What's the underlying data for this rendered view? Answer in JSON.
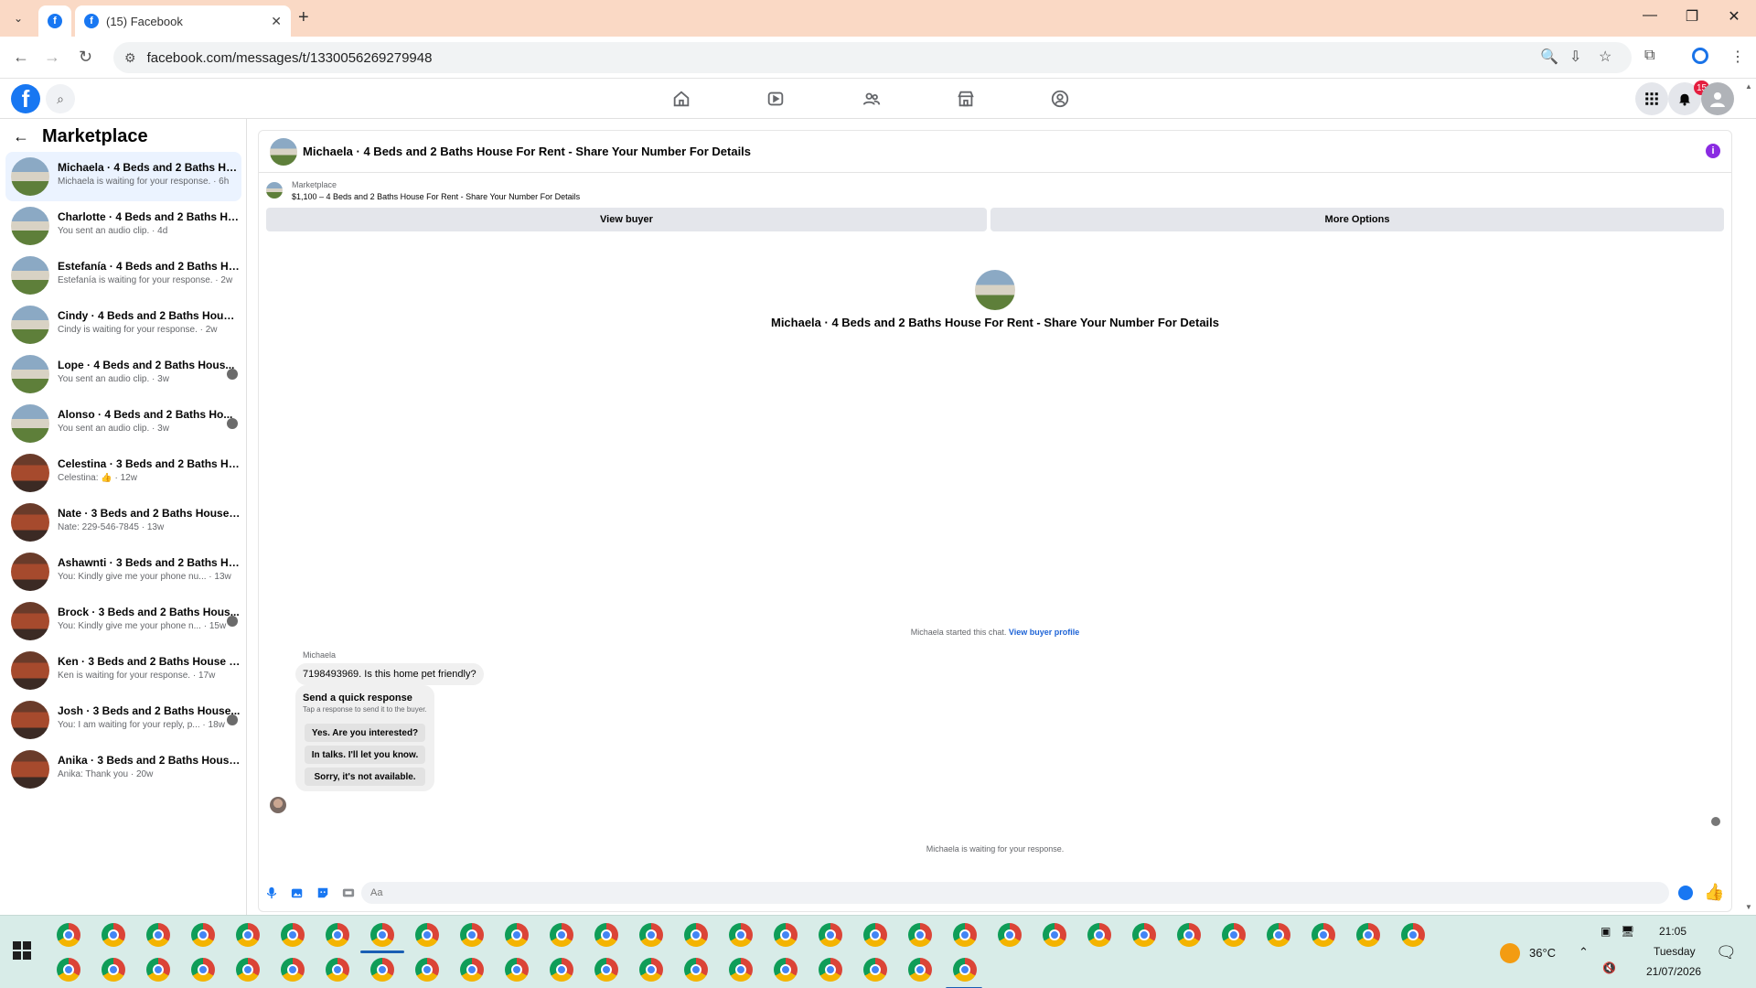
{
  "browser": {
    "tab_title": "(15) Facebook",
    "url": "facebook.com/messages/t/1330056269279948"
  },
  "fb": {
    "notif_count": "15"
  },
  "sidebar": {
    "title": "Marketplace",
    "items": [
      {
        "title": "Michaela · 4 Beds and 2 Baths Hou...",
        "sub": "Michaela is waiting for your response. · 6h",
        "thumb": "green",
        "seen": false
      },
      {
        "title": "Charlotte · 4 Beds and 2 Baths Ho...",
        "sub": "You sent an audio clip. · 4d",
        "thumb": "green",
        "seen": false
      },
      {
        "title": "Estefanía · 4 Beds and 2 Baths Hou...",
        "sub": "Estefanía is waiting for your response. · 2w",
        "thumb": "green",
        "seen": false
      },
      {
        "title": "Cindy · 4 Beds and 2 Baths House ...",
        "sub": "Cindy is waiting for your response. · 2w",
        "thumb": "green",
        "seen": false
      },
      {
        "title": "Lope · 4 Beds and 2 Baths Hous...",
        "sub": "You sent an audio clip. · 3w",
        "thumb": "green",
        "seen": true
      },
      {
        "title": "Alonso · 4 Beds and 2 Baths Ho...",
        "sub": "You sent an audio clip. · 3w",
        "thumb": "green",
        "seen": true
      },
      {
        "title": "Celestina · 3 Beds and 2 Baths Hou...",
        "sub": "Celestina: 👍 · 12w",
        "thumb": "brick",
        "seen": false
      },
      {
        "title": "Nate · 3 Beds and 2 Baths House F...",
        "sub": "Nate: 229-546-7845 · 13w",
        "thumb": "brick",
        "seen": false
      },
      {
        "title": "Ashawnti · 3 Beds and 2 Baths Ho...",
        "sub": "You: Kindly give me your phone nu... · 13w",
        "thumb": "brick",
        "seen": false
      },
      {
        "title": "Brock · 3 Beds and 2 Baths Hous...",
        "sub": "You: Kindly give me your phone n... · 15w",
        "thumb": "brick",
        "seen": true
      },
      {
        "title": "Ken · 3 Beds and 2 Baths House Fo...",
        "sub": "Ken is waiting for your response. · 17w",
        "thumb": "brick",
        "seen": false
      },
      {
        "title": "Josh · 3 Beds and 2 Baths House...",
        "sub": "You: I am waiting for your reply, p... · 18w",
        "thumb": "brick",
        "seen": true
      },
      {
        "title": "Anika · 3 Beds and 2 Baths House ...",
        "sub": "Anika: Thank you · 20w",
        "thumb": "brick",
        "seen": false
      }
    ]
  },
  "chat": {
    "title": "Michaela · 4 Beds and 2 Baths House For Rent - Share Your Number For Details",
    "marketplace_label": "Marketplace",
    "listing": "$1,100 – 4 Beds and 2 Baths House For Rent - Share Your Number For Details",
    "view_buyer": "View buyer",
    "more_options": "More Options",
    "center_title": "Michaela · 4 Beds and 2 Baths House For Rent - Share Your Number For Details",
    "started_text": "Michaela started this chat.",
    "view_profile": "View buyer profile",
    "sender": "Michaela",
    "message": "7198493969. Is this home pet friendly?",
    "quick_title": "Send a quick response",
    "quick_sub": "Tap a response to send it to the buyer.",
    "quick_options": [
      "Yes. Are you interested?",
      "In talks. I'll let you know.",
      "Sorry, it's not available."
    ],
    "waiting": "Michaela is waiting for your response.",
    "placeholder": "Aa"
  },
  "taskbar": {
    "temperature": "36°C",
    "time": "21:05",
    "day": "Tuesday",
    "date": "21/07/2026"
  }
}
